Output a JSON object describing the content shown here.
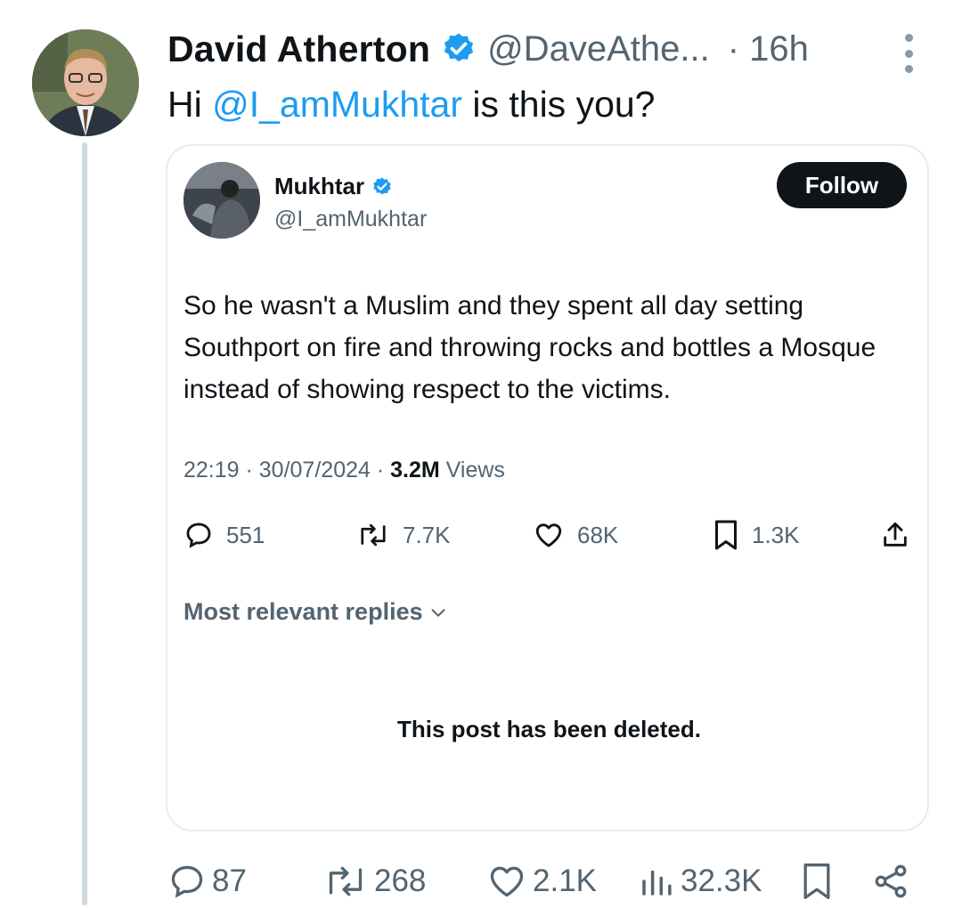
{
  "tweet": {
    "author_name": "David Atherton",
    "author_handle": "@DaveAthe...",
    "time": "· 16h",
    "text_prefix": "Hi ",
    "mention": "@I_amMukhtar",
    "text_suffix": " is this you?",
    "actions": {
      "replies": "87",
      "reposts": "268",
      "likes": "2.1K",
      "views": "32.3K"
    }
  },
  "quoted": {
    "author_name": "Mukhtar",
    "author_handle": "@I_amMukhtar",
    "follow_label": "Follow",
    "text": "So he wasn't a Muslim and they spent all day setting Southport on fire and throwing rocks and bottles a Mosque instead of showing respect to the victims.",
    "timestamp": "22:19 · 30/07/2024 · ",
    "views_count": "3.2M",
    "views_label": " Views",
    "actions": {
      "replies": "551",
      "reposts": "7.7K",
      "likes": "68K",
      "bookmarks": "1.3K"
    },
    "replies_filter": "Most relevant replies",
    "deleted_notice": "This post has been deleted."
  },
  "colors": {
    "accent": "#1d9bf0",
    "text": "#0f1419",
    "secondary": "#536471",
    "border": "#e6ecf0"
  }
}
